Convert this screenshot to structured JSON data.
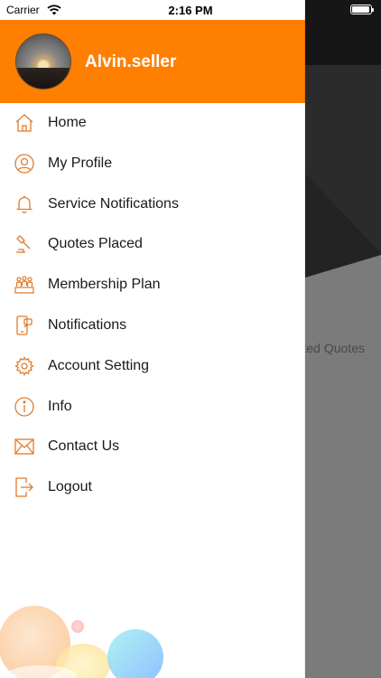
{
  "status_bar": {
    "carrier": "Carrier",
    "time": "2:16 PM"
  },
  "colors": {
    "accent": "#ff7f00",
    "icon_stroke": "#e07b2c",
    "text": "#1a1a1a"
  },
  "drawer": {
    "user_name": "Alvin.seller",
    "menu": [
      {
        "label": "Home",
        "icon": "home-icon"
      },
      {
        "label": "My Profile",
        "icon": "user-icon"
      },
      {
        "label": "Service Notifications",
        "icon": "bell-icon"
      },
      {
        "label": "Quotes Placed",
        "icon": "gavel-icon"
      },
      {
        "label": "Membership Plan",
        "icon": "team-icon"
      },
      {
        "label": "Notifications",
        "icon": "phone-notification-icon"
      },
      {
        "label": "Account Setting",
        "icon": "gear-icon"
      },
      {
        "label": "Info",
        "icon": "info-icon"
      },
      {
        "label": "Contact Us",
        "icon": "mail-icon"
      },
      {
        "label": "Logout",
        "icon": "logout-icon"
      }
    ]
  },
  "background_screen": {
    "partial_text": "ted Quotes"
  }
}
